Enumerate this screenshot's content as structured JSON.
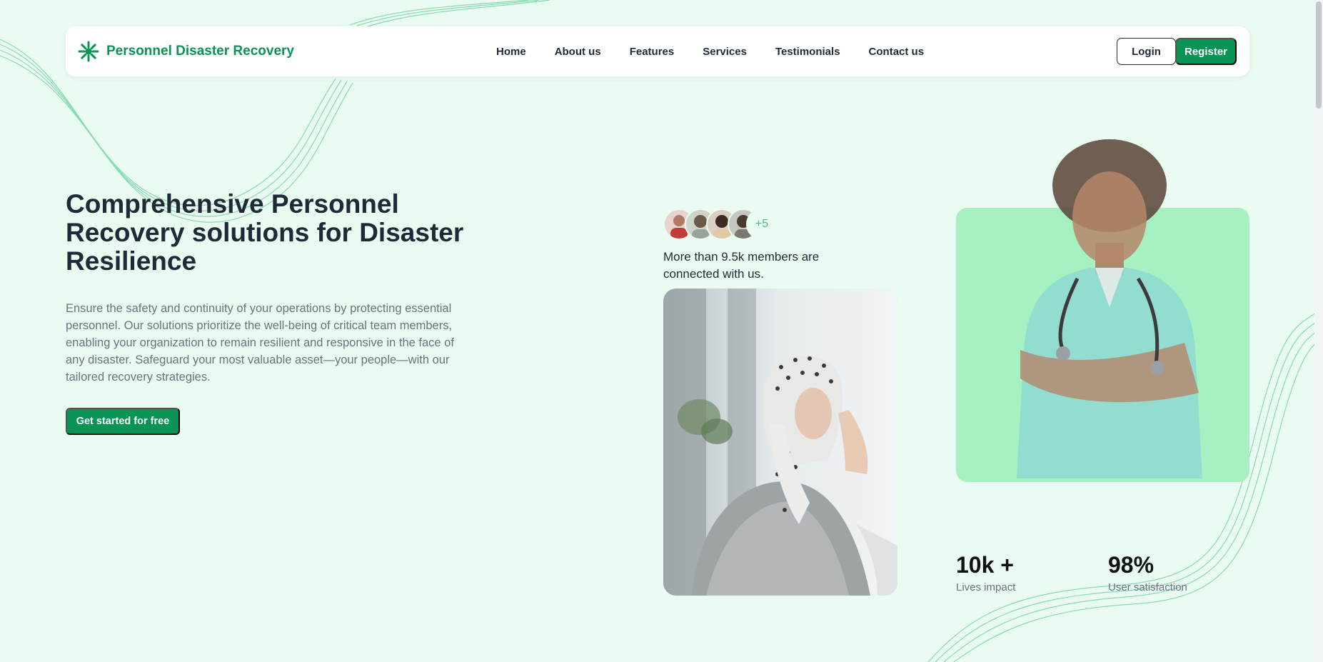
{
  "brand": {
    "name": "Personnel Disaster Recovery",
    "logo_icon": "starburst-icon",
    "color": "#079455"
  },
  "nav": {
    "items": [
      {
        "label": "Home"
      },
      {
        "label": "About us"
      },
      {
        "label": "Features"
      },
      {
        "label": "Services"
      },
      {
        "label": "Testimonials"
      },
      {
        "label": "Contact us"
      }
    ],
    "login_label": "Login",
    "register_label": "Register"
  },
  "hero": {
    "title": "Comprehensive Personnel Recovery solutions for Disaster Resilience",
    "description": "Ensure the safety and continuity of your operations by protecting essential personnel. Our solutions prioritize the well-being of critical team members, enabling your organization to remain resilient and responsive in the face of any disaster. Safeguard your most valuable asset—your people—with our tailored recovery strategies.",
    "cta_label": "Get started for free"
  },
  "members": {
    "more_count": "+5",
    "text": "More than 9.5k members are connected with us."
  },
  "stats": [
    {
      "value": "10k +",
      "label": "Lives impact"
    },
    {
      "value": "98%",
      "label": "User satisfaction"
    }
  ],
  "colors": {
    "accent": "#079455",
    "background": "#eafbf1",
    "card": "#a6f0c2"
  }
}
